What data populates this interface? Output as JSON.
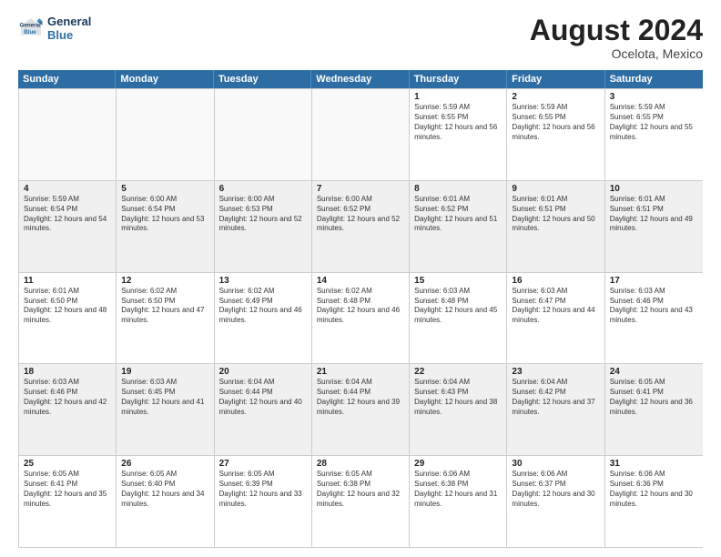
{
  "logo": {
    "line1": "General",
    "line2": "Blue"
  },
  "title": "August 2024",
  "location": "Ocelota, Mexico",
  "days_of_week": [
    "Sunday",
    "Monday",
    "Tuesday",
    "Wednesday",
    "Thursday",
    "Friday",
    "Saturday"
  ],
  "weeks": [
    [
      {
        "day": "",
        "sunrise": "",
        "sunset": "",
        "daylight": "",
        "empty": true
      },
      {
        "day": "",
        "sunrise": "",
        "sunset": "",
        "daylight": "",
        "empty": true
      },
      {
        "day": "",
        "sunrise": "",
        "sunset": "",
        "daylight": "",
        "empty": true
      },
      {
        "day": "",
        "sunrise": "",
        "sunset": "",
        "daylight": "",
        "empty": true
      },
      {
        "day": "1",
        "sunrise": "Sunrise: 5:59 AM",
        "sunset": "Sunset: 6:55 PM",
        "daylight": "Daylight: 12 hours and 56 minutes."
      },
      {
        "day": "2",
        "sunrise": "Sunrise: 5:59 AM",
        "sunset": "Sunset: 6:55 PM",
        "daylight": "Daylight: 12 hours and 56 minutes."
      },
      {
        "day": "3",
        "sunrise": "Sunrise: 5:59 AM",
        "sunset": "Sunset: 6:55 PM",
        "daylight": "Daylight: 12 hours and 55 minutes."
      }
    ],
    [
      {
        "day": "4",
        "sunrise": "Sunrise: 5:59 AM",
        "sunset": "Sunset: 6:54 PM",
        "daylight": "Daylight: 12 hours and 54 minutes."
      },
      {
        "day": "5",
        "sunrise": "Sunrise: 6:00 AM",
        "sunset": "Sunset: 6:54 PM",
        "daylight": "Daylight: 12 hours and 53 minutes."
      },
      {
        "day": "6",
        "sunrise": "Sunrise: 6:00 AM",
        "sunset": "Sunset: 6:53 PM",
        "daylight": "Daylight: 12 hours and 52 minutes."
      },
      {
        "day": "7",
        "sunrise": "Sunrise: 6:00 AM",
        "sunset": "Sunset: 6:52 PM",
        "daylight": "Daylight: 12 hours and 52 minutes."
      },
      {
        "day": "8",
        "sunrise": "Sunrise: 6:01 AM",
        "sunset": "Sunset: 6:52 PM",
        "daylight": "Daylight: 12 hours and 51 minutes."
      },
      {
        "day": "9",
        "sunrise": "Sunrise: 6:01 AM",
        "sunset": "Sunset: 6:51 PM",
        "daylight": "Daylight: 12 hours and 50 minutes."
      },
      {
        "day": "10",
        "sunrise": "Sunrise: 6:01 AM",
        "sunset": "Sunset: 6:51 PM",
        "daylight": "Daylight: 12 hours and 49 minutes."
      }
    ],
    [
      {
        "day": "11",
        "sunrise": "Sunrise: 6:01 AM",
        "sunset": "Sunset: 6:50 PM",
        "daylight": "Daylight: 12 hours and 48 minutes."
      },
      {
        "day": "12",
        "sunrise": "Sunrise: 6:02 AM",
        "sunset": "Sunset: 6:50 PM",
        "daylight": "Daylight: 12 hours and 47 minutes."
      },
      {
        "day": "13",
        "sunrise": "Sunrise: 6:02 AM",
        "sunset": "Sunset: 6:49 PM",
        "daylight": "Daylight: 12 hours and 46 minutes."
      },
      {
        "day": "14",
        "sunrise": "Sunrise: 6:02 AM",
        "sunset": "Sunset: 6:48 PM",
        "daylight": "Daylight: 12 hours and 46 minutes."
      },
      {
        "day": "15",
        "sunrise": "Sunrise: 6:03 AM",
        "sunset": "Sunset: 6:48 PM",
        "daylight": "Daylight: 12 hours and 45 minutes."
      },
      {
        "day": "16",
        "sunrise": "Sunrise: 6:03 AM",
        "sunset": "Sunset: 6:47 PM",
        "daylight": "Daylight: 12 hours and 44 minutes."
      },
      {
        "day": "17",
        "sunrise": "Sunrise: 6:03 AM",
        "sunset": "Sunset: 6:46 PM",
        "daylight": "Daylight: 12 hours and 43 minutes."
      }
    ],
    [
      {
        "day": "18",
        "sunrise": "Sunrise: 6:03 AM",
        "sunset": "Sunset: 6:46 PM",
        "daylight": "Daylight: 12 hours and 42 minutes."
      },
      {
        "day": "19",
        "sunrise": "Sunrise: 6:03 AM",
        "sunset": "Sunset: 6:45 PM",
        "daylight": "Daylight: 12 hours and 41 minutes."
      },
      {
        "day": "20",
        "sunrise": "Sunrise: 6:04 AM",
        "sunset": "Sunset: 6:44 PM",
        "daylight": "Daylight: 12 hours and 40 minutes."
      },
      {
        "day": "21",
        "sunrise": "Sunrise: 6:04 AM",
        "sunset": "Sunset: 6:44 PM",
        "daylight": "Daylight: 12 hours and 39 minutes."
      },
      {
        "day": "22",
        "sunrise": "Sunrise: 6:04 AM",
        "sunset": "Sunset: 6:43 PM",
        "daylight": "Daylight: 12 hours and 38 minutes."
      },
      {
        "day": "23",
        "sunrise": "Sunrise: 6:04 AM",
        "sunset": "Sunset: 6:42 PM",
        "daylight": "Daylight: 12 hours and 37 minutes."
      },
      {
        "day": "24",
        "sunrise": "Sunrise: 6:05 AM",
        "sunset": "Sunset: 6:41 PM",
        "daylight": "Daylight: 12 hours and 36 minutes."
      }
    ],
    [
      {
        "day": "25",
        "sunrise": "Sunrise: 6:05 AM",
        "sunset": "Sunset: 6:41 PM",
        "daylight": "Daylight: 12 hours and 35 minutes."
      },
      {
        "day": "26",
        "sunrise": "Sunrise: 6:05 AM",
        "sunset": "Sunset: 6:40 PM",
        "daylight": "Daylight: 12 hours and 34 minutes."
      },
      {
        "day": "27",
        "sunrise": "Sunrise: 6:05 AM",
        "sunset": "Sunset: 6:39 PM",
        "daylight": "Daylight: 12 hours and 33 minutes."
      },
      {
        "day": "28",
        "sunrise": "Sunrise: 6:05 AM",
        "sunset": "Sunset: 6:38 PM",
        "daylight": "Daylight: 12 hours and 32 minutes."
      },
      {
        "day": "29",
        "sunrise": "Sunrise: 6:06 AM",
        "sunset": "Sunset: 6:38 PM",
        "daylight": "Daylight: 12 hours and 31 minutes."
      },
      {
        "day": "30",
        "sunrise": "Sunrise: 6:06 AM",
        "sunset": "Sunset: 6:37 PM",
        "daylight": "Daylight: 12 hours and 30 minutes."
      },
      {
        "day": "31",
        "sunrise": "Sunrise: 6:06 AM",
        "sunset": "Sunset: 6:36 PM",
        "daylight": "Daylight: 12 hours and 30 minutes."
      }
    ]
  ]
}
